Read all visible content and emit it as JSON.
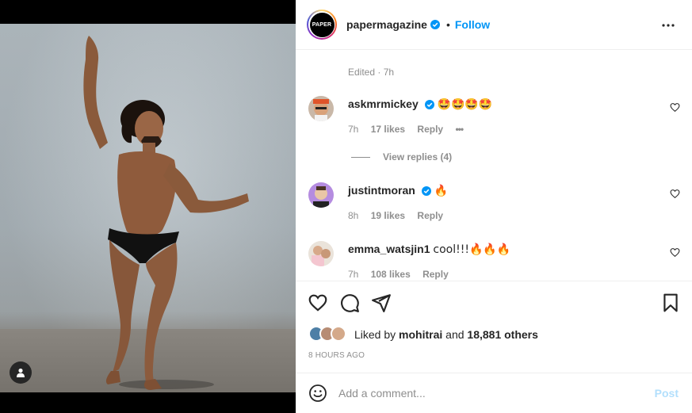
{
  "post": {
    "username": "papermagazine",
    "avatar_text": "PAPER",
    "separator": "•",
    "follow_label": "Follow",
    "caption_tail": "",
    "edited_label": "Edited · 7h"
  },
  "comments": [
    {
      "username": "askmrmickey",
      "text": "🤩🤩🤩🤩",
      "time": "7h",
      "likes": "17 likes",
      "reply": "Reply",
      "more": "•••",
      "view_replies": "View replies (4)"
    },
    {
      "username": "justintmoran",
      "text": "🔥",
      "time": "8h",
      "likes": "19 likes",
      "reply": "Reply"
    },
    {
      "username": "emma_watsjin1",
      "text": "cool!!!🔥🔥🔥",
      "time": "7h",
      "likes": "108 likes",
      "reply": "Reply"
    }
  ],
  "likes": {
    "prefix": "Liked by",
    "user": "mohitrai",
    "joiner": "and",
    "others": "18,881 others"
  },
  "timestamp": "8 HOURS AGO",
  "add_comment": {
    "placeholder": "Add a comment...",
    "post_label": "Post"
  },
  "colors": {
    "accent": "#0095f6",
    "secondary_text": "#8e8e8e",
    "post_disabled": "#b2dffc"
  }
}
